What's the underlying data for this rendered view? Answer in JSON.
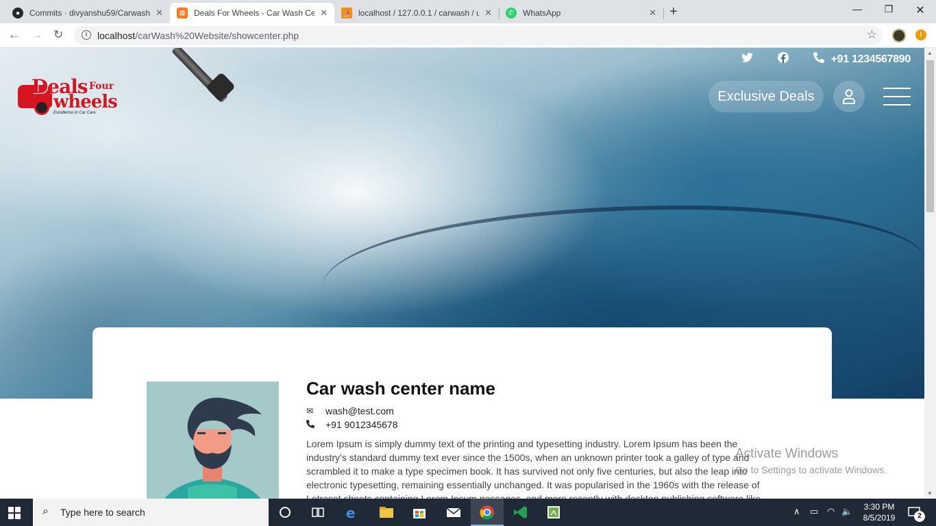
{
  "browser": {
    "tabs": [
      {
        "label": "Commits · divyanshu59/Carwash\\",
        "favicon": "github-icon"
      },
      {
        "label": "Deals For Wheels - Car Wash Cen",
        "favicon": "xampp-icon"
      },
      {
        "label": "localhost / 127.0.0.1 / carwash / u",
        "favicon": "phpmyadmin-icon"
      },
      {
        "label": "WhatsApp",
        "favicon": "whatsapp-icon"
      }
    ],
    "url_host": "localhost",
    "url_path": "/carWash%20Website/showcenter.php"
  },
  "site": {
    "logo": {
      "line1": "Deals",
      "line2": "Four",
      "line3": "wheels",
      "tagline": "Excellence In Car Care"
    },
    "phone": "+91 1234567890",
    "exclusive_deals": "Exclusive Deals"
  },
  "center": {
    "name": "Car wash center name",
    "email": "wash@test.com",
    "phone": "+91 9012345678",
    "description": "Lorem Ipsum is simply dummy text of the printing and typesetting industry. Lorem Ipsum has been the industry's standard dummy text ever since the 1500s, when an unknown printer took a galley of type and scrambled it to make a type specimen book. It has survived not only five centuries, but also the leap into electronic typesetting, remaining essentially unchanged. It was popularised in the 1960s with the release of Letraset sheets containing Lorem Ipsum passages, and more recently with desktop publishing software like"
  },
  "watermark": {
    "title": "Activate Windows",
    "subtitle": "Go to Settings to activate Windows."
  },
  "taskbar": {
    "search_placeholder": "Type here to search",
    "time": "3:30 PM",
    "date": "8/5/2019",
    "notifications": "2"
  }
}
